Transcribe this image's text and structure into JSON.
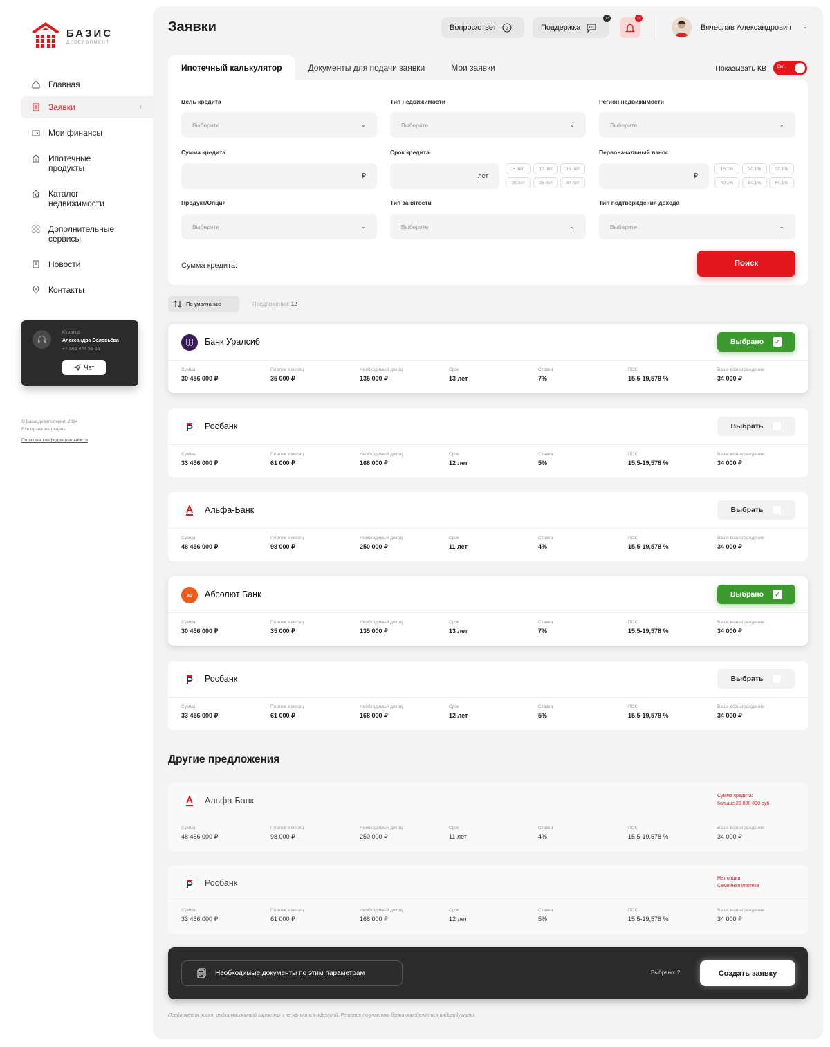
{
  "brand": {
    "name": "БАЗИС",
    "sub": "ДЕВЕЛОПМЕНТ"
  },
  "sidebar": {
    "items": [
      {
        "label": "Главная",
        "icon": "home-icon"
      },
      {
        "label": "Заявки",
        "icon": "document-icon"
      },
      {
        "label": "Мои финансы",
        "icon": "wallet-icon"
      },
      {
        "label": "Ипотечные продукты",
        "icon": "percent-icon"
      },
      {
        "label": "Каталог недвижимости",
        "icon": "catalog-icon"
      },
      {
        "label": "Дополнительные сервисы",
        "icon": "services-icon"
      },
      {
        "label": "Новости",
        "icon": "news-icon"
      },
      {
        "label": "Контакты",
        "icon": "location-icon"
      }
    ],
    "curator": {
      "title": "Куратор",
      "name": "Александра Соловьёва",
      "phone": "+7 565 444 55 66",
      "chat": "Чат"
    },
    "footer": {
      "copyright": "© Базисдевелопмент, 2024",
      "rights": "Все права защищены",
      "policy": "Политика конфиденциальности"
    }
  },
  "header": {
    "title": "Заявки",
    "faq": "Вопрос/ответ",
    "support": "Поддержка",
    "support_badge": "12",
    "bell_badge": "21",
    "user": "Вячеслав Александрович"
  },
  "tabs": [
    "Ипотечный калькулятор",
    "Документы для подачи заявки",
    "Мои заявки"
  ],
  "kv": {
    "label": "Показывать КВ",
    "state": "Вкл."
  },
  "form": {
    "goal": {
      "label": "Цель кредита",
      "placeholder": "Выберите"
    },
    "property_type": {
      "label": "Тип недвижимости",
      "placeholder": "Выберите"
    },
    "region": {
      "label": "Регион недвижимости",
      "placeholder": "Выберите"
    },
    "amount": {
      "label": "Сумма кредита",
      "suffix": "₽"
    },
    "term": {
      "label": "Срок кредита",
      "suffix": "лет",
      "chips": [
        "5 лет",
        "10 лет",
        "15 лет",
        "20 лет",
        "25 лет",
        "30 лет"
      ]
    },
    "down": {
      "label": "Первоначальный взнос",
      "suffix": "₽",
      "chips": [
        "15,1%",
        "20,1%",
        "30,1%",
        "40,1%",
        "50,1%",
        "60,1%"
      ]
    },
    "product": {
      "label": "Продукт/Опция",
      "placeholder": "Выберите"
    },
    "employment": {
      "label": "Тип занятости",
      "placeholder": "Выберите"
    },
    "income": {
      "label": "Тип подтверждения дохода",
      "placeholder": "Выберите"
    },
    "sum_label": "Сумма кредита:",
    "search": "Поиск"
  },
  "sort": {
    "label": "По умолчанию",
    "count_label": "Предложения:",
    "count": "12"
  },
  "stat_labels": [
    "Сумма",
    "Платеж в месяц",
    "Необходимый доход",
    "Срок",
    "Ставка",
    "ПСК",
    "Ваше вознаграждение"
  ],
  "offers": [
    {
      "bank": "Банк Уралсиб",
      "logo": "uralsib-logo",
      "btn": "Выбрано",
      "selected": true,
      "values": [
        "30 456 000 ₽",
        "35 000 ₽",
        "135 000 ₽",
        "13 лет",
        "7%",
        "15,5-19,578 %",
        "34 000 ₽"
      ]
    },
    {
      "bank": "Росбанк",
      "logo": "rosbank-logo",
      "btn": "Выбрать",
      "selected": false,
      "values": [
        "33 456 000 ₽",
        "61 000 ₽",
        "168 000 ₽",
        "12 лет",
        "5%",
        "15,5-19,578 %",
        "34 000 ₽"
      ]
    },
    {
      "bank": "Альфа-Банк",
      "logo": "alfa-logo",
      "btn": "Выбрать",
      "selected": false,
      "values": [
        "48 456 000 ₽",
        "98 000 ₽",
        "250 000 ₽",
        "11 лет",
        "4%",
        "15,5-19,578 %",
        "34 000 ₽"
      ]
    },
    {
      "bank": "Абсолют Банк",
      "logo": "absolut-logo",
      "btn": "Выбрано",
      "selected": true,
      "values": [
        "30 456 000 ₽",
        "35 000 ₽",
        "135 000 ₽",
        "13 лет",
        "7%",
        "15,5-19,578 %",
        "34 000 ₽"
      ]
    },
    {
      "bank": "Росбанк",
      "logo": "rosbank-logo",
      "btn": "Выбрать",
      "selected": false,
      "values": [
        "33 456 000 ₽",
        "61 000 ₽",
        "168 000 ₽",
        "12 лет",
        "5%",
        "15,5-19,578 %",
        "34 000 ₽"
      ]
    }
  ],
  "other_title": "Другие предложения",
  "other_offers": [
    {
      "bank": "Альфа-Банк",
      "logo": "alfa-logo",
      "note1": "Сумма кредита:",
      "note2": "больше 25 000 000 руб.",
      "values": [
        "48 456 000 ₽",
        "98 000 ₽",
        "250 000 ₽",
        "11 лет",
        "4%",
        "15,5-19,578 %",
        "34 000 ₽"
      ]
    },
    {
      "bank": "Росбанк",
      "logo": "rosbank-logo",
      "note1": "Нет опции:",
      "note2": "Семейная ипотека",
      "values": [
        "33 456 000 ₽",
        "61 000 ₽",
        "168 000 ₽",
        "12 лет",
        "5%",
        "15,5-19,578 %",
        "34 000 ₽"
      ]
    }
  ],
  "bottom": {
    "docs": "Необходимые документы по этим параметрам",
    "chosen": "Выбрано: 2",
    "create": "Создать заявку"
  },
  "disclaimer": "Предложения носят информационный характер и не являются офертой. Решение по участию банка определяется индивидуально.",
  "colors": {
    "accent": "#e3161c",
    "success": "#3c9a2e",
    "dark": "#2b2b2b"
  }
}
